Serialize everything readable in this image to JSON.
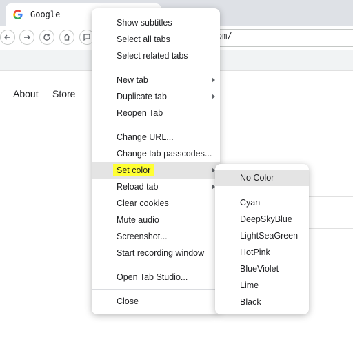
{
  "browser": {
    "tab_title": "Google",
    "url_visible": "le.com/"
  },
  "page": {
    "links": [
      "About",
      "Store"
    ]
  },
  "context_menu": {
    "items": [
      {
        "label": "Show subtitles",
        "submenu": false
      },
      {
        "label": "Select all tabs",
        "submenu": false
      },
      {
        "label": "Select related tabs",
        "submenu": false
      },
      {
        "label": "New tab",
        "submenu": true
      },
      {
        "label": "Duplicate tab",
        "submenu": true
      },
      {
        "label": "Reopen Tab",
        "submenu": false
      },
      {
        "label": "Change URL...",
        "submenu": false
      },
      {
        "label": "Change tab passcodes...",
        "submenu": false
      },
      {
        "label": "Set color",
        "submenu": true,
        "highlighted": true
      },
      {
        "label": "Reload tab",
        "submenu": true
      },
      {
        "label": "Clear cookies",
        "submenu": false
      },
      {
        "label": "Mute audio",
        "submenu": false
      },
      {
        "label": "Screenshot...",
        "submenu": false
      },
      {
        "label": "Start recording window",
        "submenu": false
      },
      {
        "label": "Open Tab Studio...",
        "submenu": false
      },
      {
        "label": "Close",
        "submenu": false
      }
    ]
  },
  "color_submenu": {
    "items": [
      "No Color",
      "Cyan",
      "DeepSkyBlue",
      "LightSeaGreen",
      "HotPink",
      "BlueViolet",
      "Lime",
      "Black"
    ]
  },
  "colors": {
    "highlight": "#ffff33",
    "hover_bg": "#e4e4e4",
    "chrome_bg": "#dee1e6"
  }
}
